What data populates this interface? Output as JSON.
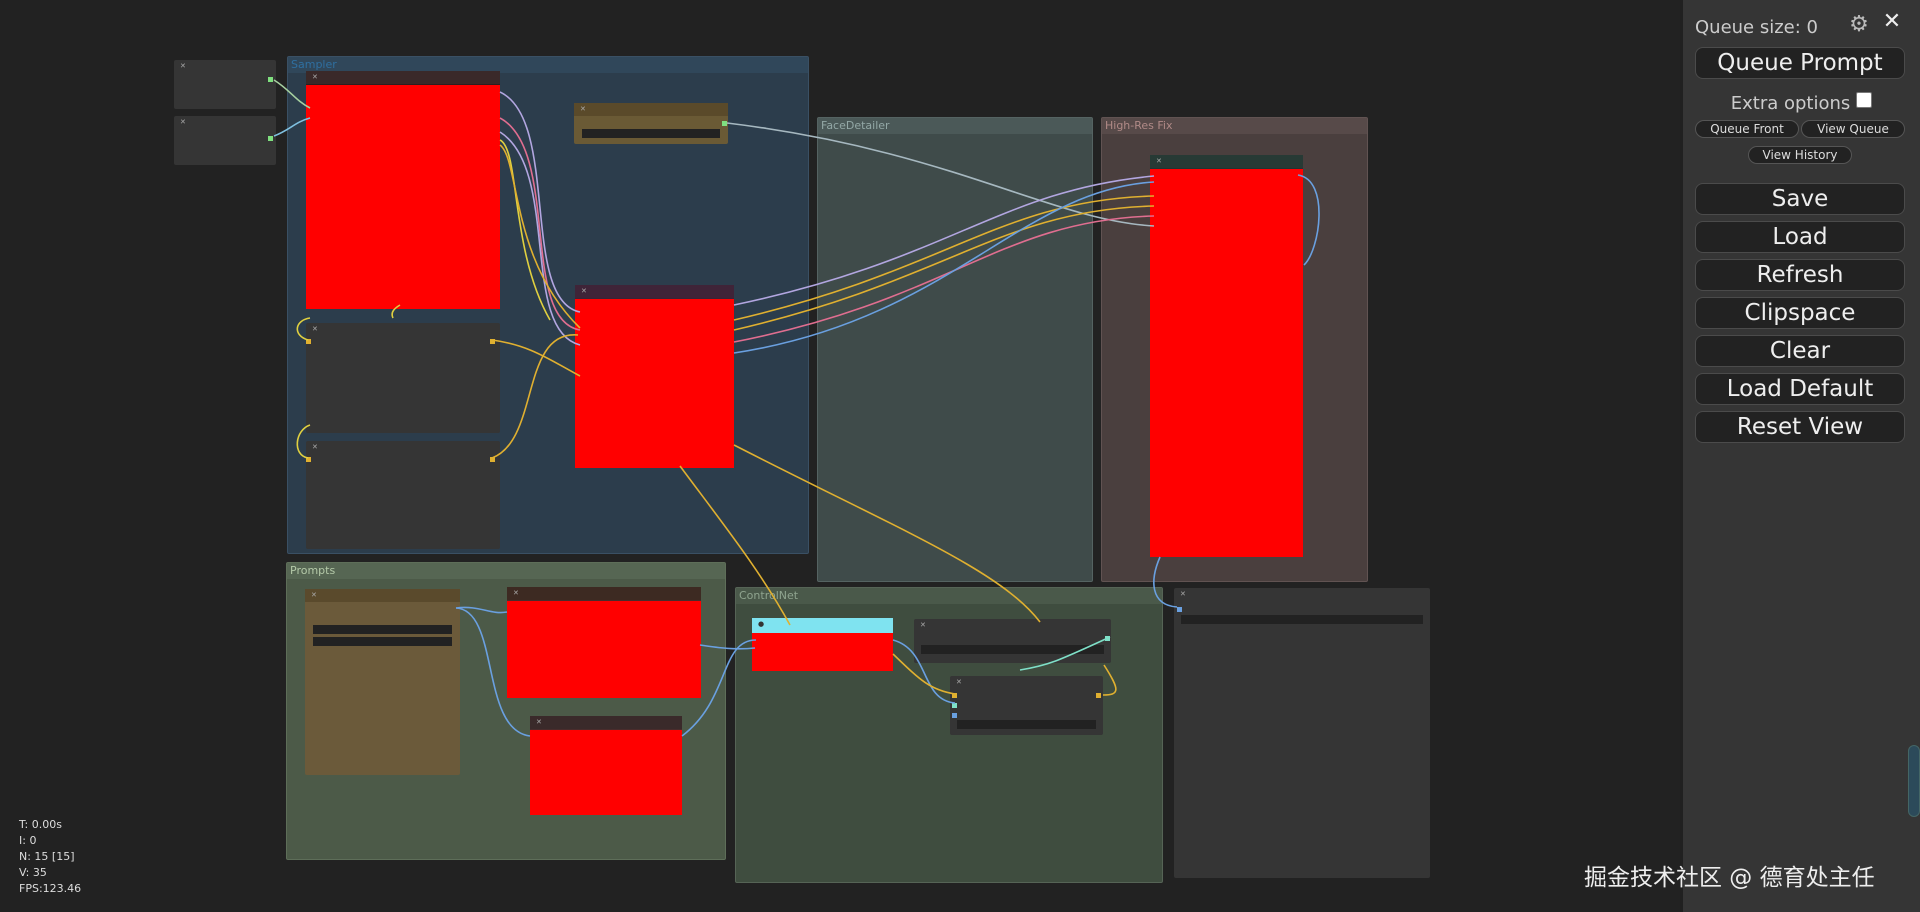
{
  "groups": {
    "sampler": "Sampler",
    "face_detailer": "FaceDetailer",
    "hires_fix": "High-Res Fix",
    "prompts": "Prompts",
    "controlnet": "ControlNet"
  },
  "stats": {
    "time": "T: 0.00s",
    "iter": "I: 0",
    "nodes": "N: 15 [15]",
    "vertices": "V: 35",
    "fps": "FPS:123.46"
  },
  "watermark": "掘金技术社区 @ 德育处主任",
  "menu": {
    "queue_size": "Queue size: 0",
    "queue_prompt": "Queue Prompt",
    "extra_options": "Extra options",
    "queue_front": "Queue Front",
    "view_queue": "View Queue",
    "view_history": "View History",
    "save": "Save",
    "load": "Load",
    "refresh": "Refresh",
    "clipspace": "Clipspace",
    "clear": "Clear",
    "load_default": "Load Default",
    "reset_view": "Reset View"
  },
  "icons": {
    "settings": "gear-icon",
    "close": "close-icon"
  },
  "colors": {
    "canvas_bg": "#222222",
    "sampler_group": "#2c3d4c",
    "facedetailer_group": "#3f4b4a",
    "hires_group": "#4a3f3e",
    "prompts_group": "#4c5a48",
    "controlnet_group": "#3f4d3f",
    "placeholder_red": "#ff0000",
    "selected_node": "#7fe3f0"
  }
}
